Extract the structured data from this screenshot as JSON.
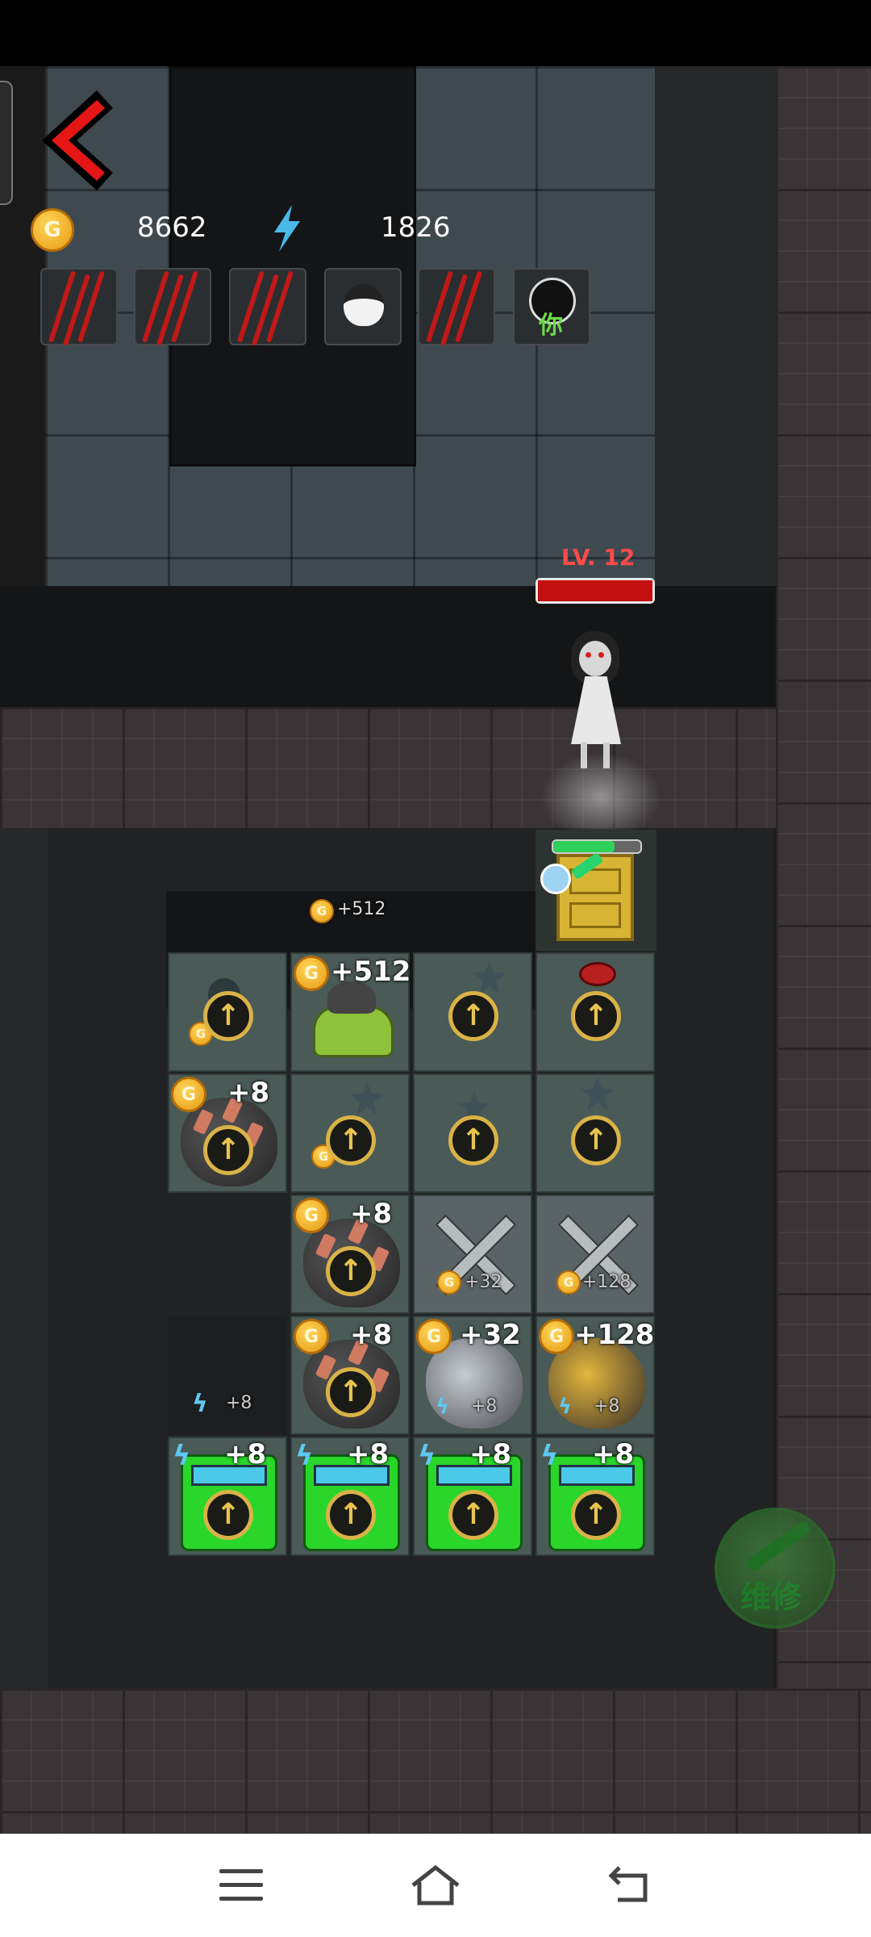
{
  "hud": {
    "gold": "8662",
    "gold_icon_letter": "G",
    "energy": "1826",
    "back_icon": "back-arrow-icon"
  },
  "status_slots": [
    {
      "icon": "claw-marks-icon"
    },
    {
      "icon": "claw-marks-icon"
    },
    {
      "icon": "claw-marks-icon"
    },
    {
      "icon": "player-face-icon"
    },
    {
      "icon": "claw-marks-icon"
    },
    {
      "icon": "you-avatar-icon",
      "label": "你"
    }
  ],
  "enemy": {
    "level_label": "LV. 12",
    "health_fraction": 1.0
  },
  "door": {
    "repair_progress": 0.7
  },
  "floating_income": "+512",
  "grid": {
    "row1": [
      {
        "item": "bomb-turret",
        "bonus": ""
      },
      {
        "item": "bed",
        "bonus": "+512"
      },
      {
        "item": "bomb-turret",
        "bonus": ""
      },
      {
        "item": "eye-turret",
        "bonus": ""
      }
    ],
    "row2": [
      {
        "item": "ore-rock",
        "bonus": "+8"
      },
      {
        "item": "bomb-turret",
        "bonus": ""
      },
      {
        "item": "bomb-turret",
        "bonus": ""
      },
      {
        "item": "bomb-turret",
        "bonus": ""
      }
    ],
    "row3": [
      {
        "item": "ore-rock",
        "bonus": "+8"
      },
      {
        "item": "tool-crate",
        "bonus": "+32"
      },
      {
        "item": "tool-crate",
        "bonus": "+128"
      }
    ],
    "row4": [
      {
        "item": "energy-drop",
        "bonus": "+8"
      },
      {
        "item": "ore-rock",
        "bonus": "+8",
        "small": "+8"
      },
      {
        "item": "silver-ore",
        "bonus": "+32",
        "small": "+8"
      },
      {
        "item": "gold-ore",
        "bonus": "+128",
        "small": "+8"
      }
    ],
    "row5": [
      {
        "item": "generator",
        "bonus": "+8"
      },
      {
        "item": "generator",
        "bonus": "+8"
      },
      {
        "item": "generator",
        "bonus": "+8"
      },
      {
        "item": "generator",
        "bonus": "+8"
      }
    ]
  },
  "repair_button": {
    "label": "维修"
  },
  "nav": {
    "menu_icon": "menu-icon",
    "home_icon": "home-icon",
    "back_icon": "back-icon"
  }
}
